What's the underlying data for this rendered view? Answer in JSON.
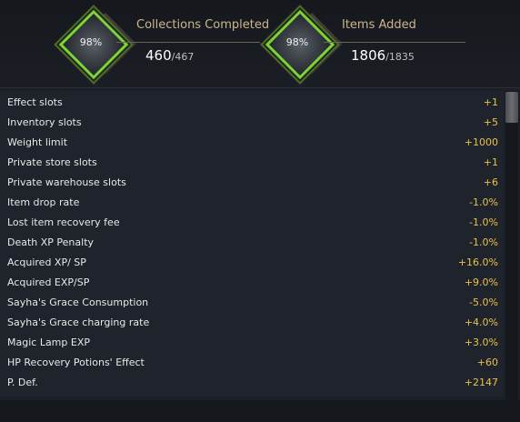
{
  "header": {
    "collections": {
      "percent": "98%",
      "title": "Collections Completed",
      "count": "460",
      "total": "/467"
    },
    "items": {
      "percent": "98%",
      "title": "Items Added",
      "count": "1806",
      "total": "/1835"
    }
  },
  "stats": [
    {
      "name": "Effect slots",
      "value": "+1"
    },
    {
      "name": "Inventory slots",
      "value": "+5"
    },
    {
      "name": "Weight limit",
      "value": "+1000"
    },
    {
      "name": "Private store slots",
      "value": "+1"
    },
    {
      "name": "Private warehouse slots",
      "value": "+6"
    },
    {
      "name": "Item drop rate",
      "value": "-1.0%"
    },
    {
      "name": "Lost item recovery fee",
      "value": "-1.0%"
    },
    {
      "name": "Death XP Penalty",
      "value": "-1.0%"
    },
    {
      "name": "Acquired XP/ SP",
      "value": "+16.0%"
    },
    {
      "name": "Acquired EXP/SP",
      "value": "+9.0%"
    },
    {
      "name": "Sayha's Grace Consumption",
      "value": "-5.0%"
    },
    {
      "name": "Sayha's Grace charging rate",
      "value": "+4.0%"
    },
    {
      "name": "Magic Lamp EXP",
      "value": "+3.0%"
    },
    {
      "name": "HP Recovery Potions' Effect",
      "value": "+60"
    },
    {
      "name": "P. Def.",
      "value": "+2147"
    }
  ],
  "colors": {
    "accent_green": "#7fd33a",
    "value_gold": "#e9c04f",
    "title_tan": "#cdb58f"
  }
}
